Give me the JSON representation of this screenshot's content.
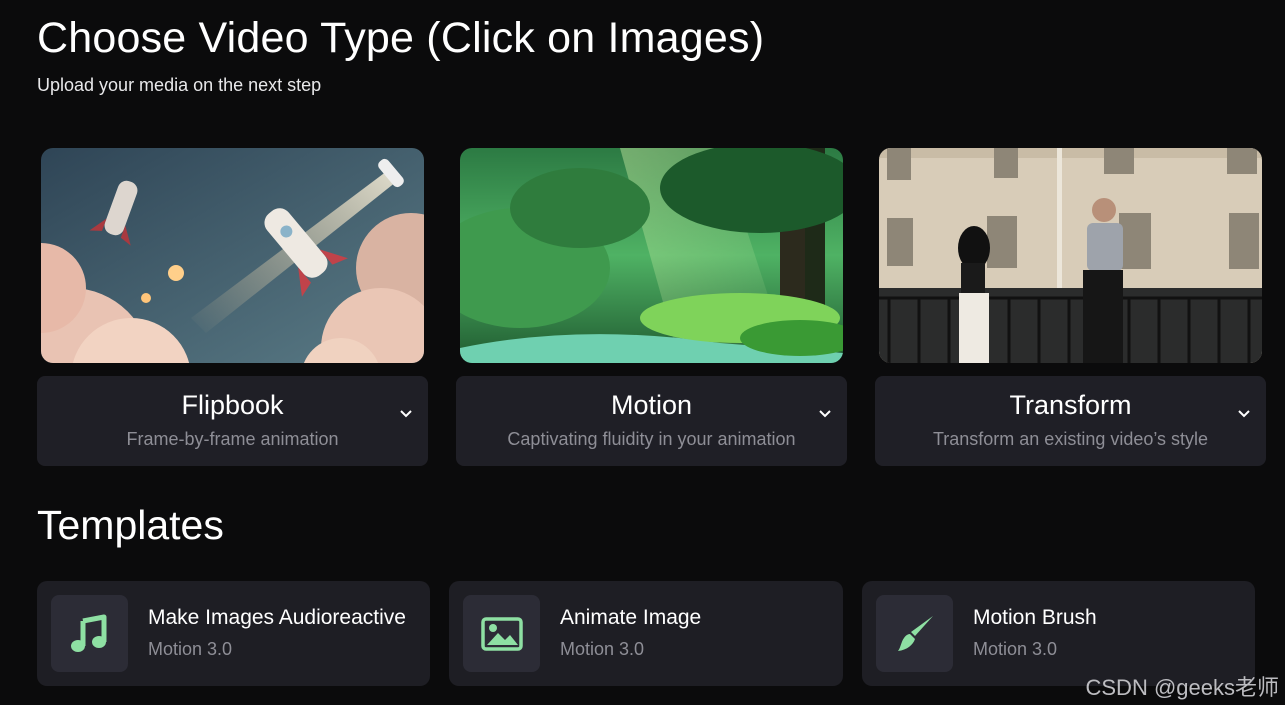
{
  "header": {
    "title": "Choose Video Type (Click on Images)",
    "subtitle": "Upload your media on the next step"
  },
  "video_types": [
    {
      "name": "Flipbook",
      "description": "Frame-by-frame animation",
      "image": "rockets-in-sky"
    },
    {
      "name": "Motion",
      "description": "Captivating fluidity in your animation",
      "image": "sunlit-forest-stream"
    },
    {
      "name": "Transform",
      "description": "Transform an existing video’s style",
      "image": "dancers-on-street"
    }
  ],
  "templates_section": {
    "title": "Templates",
    "items": [
      {
        "name": "Make Images Audioreactive",
        "version": "Motion 3.0",
        "icon": "music-note-icon"
      },
      {
        "name": "Animate Image",
        "version": "Motion 3.0",
        "icon": "image-icon"
      },
      {
        "name": "Motion Brush",
        "version": "Motion 3.0",
        "icon": "paintbrush-icon"
      }
    ]
  },
  "watermark": "CSDN @geeks老师",
  "colors": {
    "background": "#0b0b0c",
    "card": "#1f1f26",
    "icon_accent": "#8ee0a3",
    "muted_text": "#8e8e96"
  }
}
